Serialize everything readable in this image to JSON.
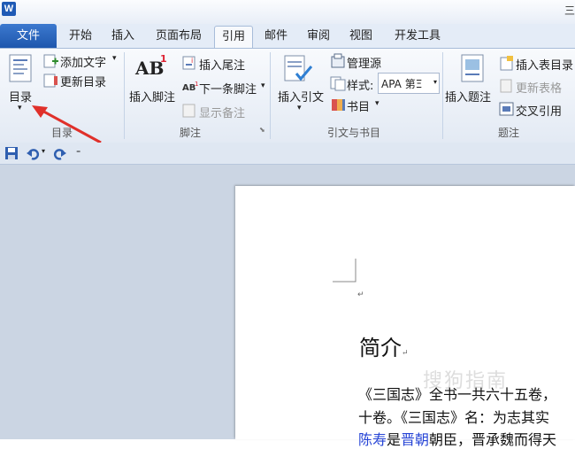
{
  "window": {
    "app_icon": "W",
    "title_fragment": "三"
  },
  "tabs": {
    "file": "文件",
    "items": [
      "开始",
      "插入",
      "页面布局",
      "引用",
      "邮件",
      "审阅",
      "视图",
      "开发工具"
    ],
    "active": "引用"
  },
  "ribbon": {
    "toc": {
      "label": "目录",
      "add_text": "添加文字",
      "update_toc": "更新目录",
      "big_button": "目录",
      "dropdown": "▾"
    },
    "footnotes": {
      "label": "脚注",
      "insert_footnote": "插入脚注",
      "ab_glyph": "AB",
      "superscript": "1",
      "insert_endnote": "插入尾注",
      "next_footnote": "下一条脚注",
      "show_notes": "显示备注",
      "launcher": "⬊"
    },
    "citations": {
      "label": "引文与书目",
      "insert_citation": "插入引文",
      "manage_sources": "管理源",
      "style_label": "样式:",
      "style_value": "APA 第Ξ",
      "bibliography": "书目"
    },
    "captions": {
      "label": "题注",
      "insert_caption": "插入题注",
      "insert_table_of_figures": "插入表目录",
      "update_table": "更新表格",
      "cross_reference": "交叉引用"
    }
  },
  "document": {
    "heading": "简介",
    "para_mark": "↵",
    "lines": [
      "《三国志》全书一共六十五卷，",
      "十卷。《三国志》名：为志其实",
      "是 朝臣，晋承魏而得天"
    ],
    "line3_link1": "陈寿",
    "line3_mid": "是",
    "line3_link2": "晋朝",
    "line3_rest": "朝臣，晋承魏而得天",
    "watermark": "搜狗指南"
  },
  "colors": {
    "file_tab": "#2a63b8",
    "arrow": "#e0302a",
    "link": "#2745d6"
  }
}
